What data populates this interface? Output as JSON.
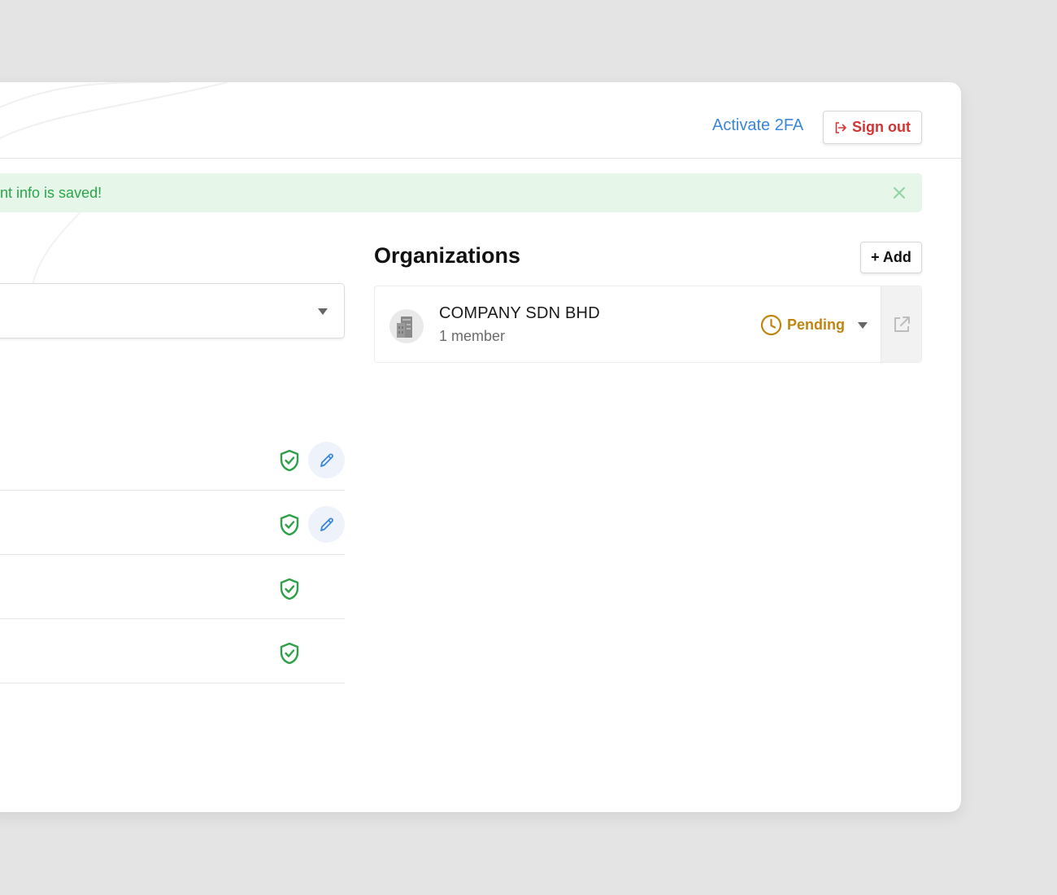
{
  "header": {
    "activate_2fa_label": "Activate 2FA",
    "sign_out_label": "Sign out"
  },
  "alert": {
    "message": "ount info is saved!"
  },
  "organizations": {
    "title": "Organizations",
    "add_label": "+ Add",
    "items": [
      {
        "name": "COMPANY SDN BHD",
        "members": "1 member",
        "status": "Pending"
      }
    ]
  },
  "colors": {
    "link_blue": "#3a86d8",
    "danger_red": "#d23434",
    "success_green": "#2aa64a",
    "pending_amber": "#c08510"
  },
  "icons": {
    "sign_out": "sign-out-icon",
    "close": "close-icon",
    "caret": "caret-down-icon",
    "shield": "shield-check-icon",
    "edit": "pencil-icon",
    "building": "building-icon",
    "clock": "clock-icon",
    "external": "external-link-icon"
  }
}
